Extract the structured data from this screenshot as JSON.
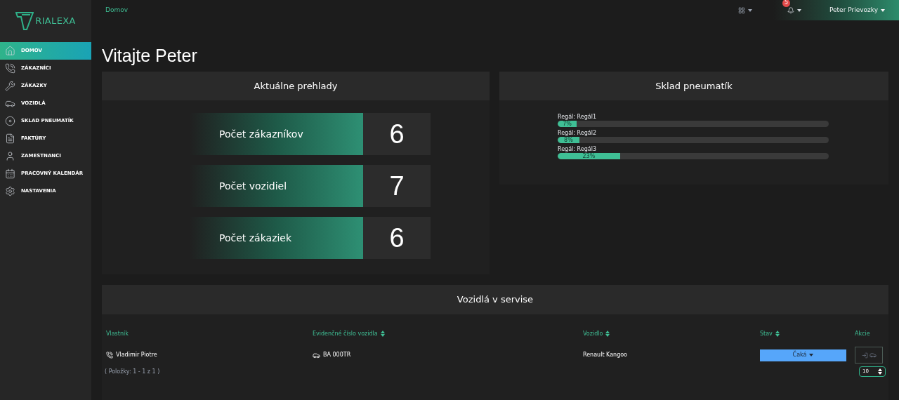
{
  "logo": {
    "text": "RIALEXA"
  },
  "sidebar": {
    "items": [
      {
        "label": "DOMOV",
        "selected": true
      },
      {
        "label": "ZÁKAZNÍCI",
        "selected": false
      },
      {
        "label": "ZÁKAZKY",
        "selected": false
      },
      {
        "label": "VOZIDLÁ",
        "selected": false
      },
      {
        "label": "SKLAD PNEUMATÍK",
        "selected": false
      },
      {
        "label": "FAKTÚRY",
        "selected": false
      },
      {
        "label": "ZAMESTNANCI",
        "selected": false
      },
      {
        "label": "PRACOVNÝ KALENDÁR",
        "selected": false
      },
      {
        "label": "NASTAVENIA",
        "selected": false
      }
    ]
  },
  "breadcrumb": "Domov",
  "topbar": {
    "notification_count": "5",
    "user": "Peter Prievozky"
  },
  "heading": "Vitajte Peter",
  "overview": {
    "title": "Aktuálne prehlady",
    "stats": [
      {
        "label": "Počet zákazníkov",
        "value": "6"
      },
      {
        "label": "Počet vozidiel",
        "value": "7"
      },
      {
        "label": "Počet zákaziek",
        "value": "6"
      }
    ]
  },
  "tire_storage": {
    "title": "Sklad pneumatík",
    "racks": [
      {
        "label": "Regál: Regál1",
        "level": 0.07,
        "reading": "7%"
      },
      {
        "label": "Regál: Regál2",
        "level": 0.08,
        "reading": "8%"
      },
      {
        "label": "Regál: Regál3",
        "level": 0.23,
        "reading": "23%"
      }
    ]
  },
  "service": {
    "title": "Vozidlá v servise",
    "columns": [
      {
        "label": "Vlastník",
        "sortable": false
      },
      {
        "label": "Evidenčné číslo vozidla",
        "sortable": true
      },
      {
        "label": "Vozidlo",
        "sortable": true
      },
      {
        "label": "Stav",
        "sortable": true
      },
      {
        "label": "Akcie",
        "sortable": false
      }
    ],
    "rows": [
      {
        "owner": "Vladimir Piotre",
        "plate": "BA 000TR",
        "vehicle": "Renault Kangoo",
        "status": "Čaká"
      }
    ],
    "pager": "( Položky: 1 - 1 z 1 )",
    "page_size": "10"
  }
}
